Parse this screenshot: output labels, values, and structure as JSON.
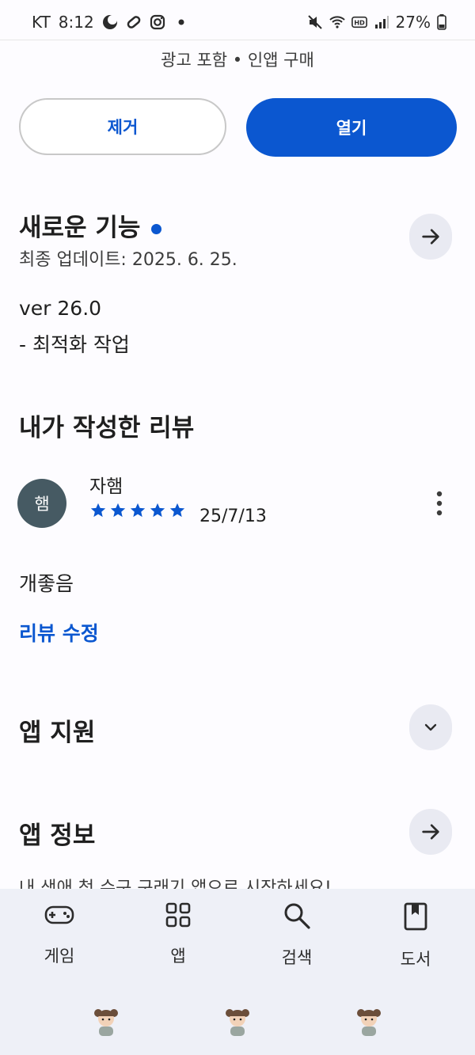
{
  "status_bar": {
    "carrier": "KT",
    "time": "8:12",
    "battery": "27%"
  },
  "app": {
    "meta_text": "광고 포함 • 인앱 구매",
    "remove_label": "제거",
    "open_label": "열기"
  },
  "whats_new": {
    "title": "새로운 기능",
    "updated": "최종 업데이트: 2025. 6. 25.",
    "version": "ver 26.0",
    "note": "- 최적화 작업"
  },
  "my_review": {
    "title": "내가 작성한 리뷰",
    "avatar_initial": "햄",
    "author": "자햄",
    "rating": 5,
    "date": "25/7/13",
    "text": "개좋음",
    "edit_label": "리뷰 수정"
  },
  "app_support": {
    "title": "앱 지원"
  },
  "app_info": {
    "title": "앱 정보",
    "preview": "내 생애 첫 수구 구래기 앱으로 시작하세요!"
  },
  "bottom_nav": [
    {
      "label": "게임",
      "icon": "gamepad-icon"
    },
    {
      "label": "앱",
      "icon": "apps-grid-icon"
    },
    {
      "label": "검색",
      "icon": "search-icon"
    },
    {
      "label": "도서",
      "icon": "book-icon"
    }
  ],
  "colors": {
    "accent": "#0b57d0",
    "avatar_bg": "#465a63",
    "nav_bg": "#eef0f7"
  }
}
